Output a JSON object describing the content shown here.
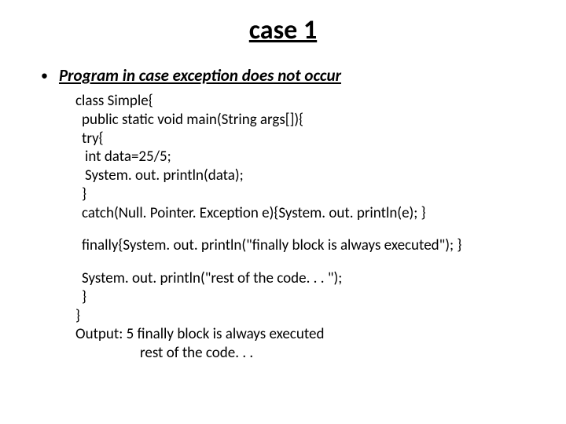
{
  "title": "case 1",
  "subheading": "Program in case exception does not occur",
  "code": {
    "l1": "class Simple{",
    "l2": "public static void main(String args[]){",
    "l3": "try{",
    "l4": "int data=25/5;",
    "l5": "System. out. println(data);",
    "l6": "}",
    "l7": "catch(Null. Pointer. Exception e){System. out. println(e); }",
    "l8": "finally{System. out. println(\"finally block is always executed\"); }",
    "l9": "System. out. println(\"rest of the code. . . \");",
    "l10": "}",
    "l11": "}",
    "l12": "Output: 5 finally block is always executed",
    "l13": "rest of the code. . ."
  }
}
